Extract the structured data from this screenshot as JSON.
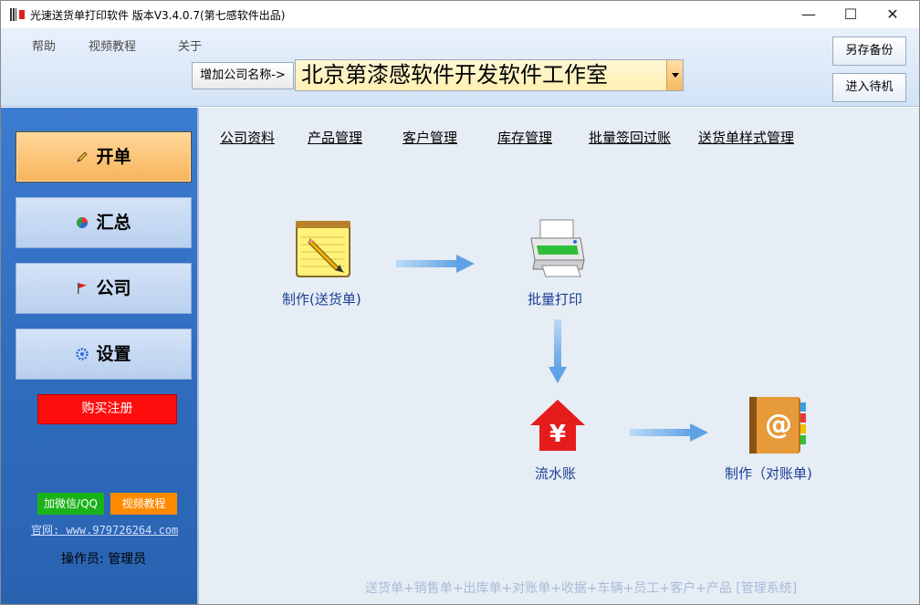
{
  "window": {
    "title": "光速送货单打印软件 版本V3.4.0.7(第七感软件出品)",
    "controls": {
      "minimize": "—",
      "maximize": "☐",
      "close": "✕"
    }
  },
  "menu": {
    "items": [
      "帮助",
      "视频教程",
      "关于"
    ]
  },
  "company": {
    "add_label": "增加公司名称->",
    "selected": "北京第漆感软件开发软件工作室"
  },
  "header_buttons": {
    "backup": "另存备份",
    "standby": "进入待机"
  },
  "sidebar": {
    "nav": [
      {
        "label": "开单",
        "icon": "pencil-icon",
        "active": true
      },
      {
        "label": "汇总",
        "icon": "pie-chart-icon",
        "active": false
      },
      {
        "label": "公司",
        "icon": "flag-icon",
        "active": false
      },
      {
        "label": "设置",
        "icon": "gear-icon",
        "active": false
      }
    ],
    "buy_label": "购买注册",
    "wechat_label": "加微信/QQ",
    "video_label": "视频教程",
    "website": "官网: www.979726264.com",
    "operator": "操作员: 管理员"
  },
  "main": {
    "top_links": [
      "公司资料",
      "产品管理",
      "客户管理",
      "库存管理",
      "批量签回过账",
      "送货单样式管理"
    ],
    "flow": {
      "make_delivery": "制作(送货单)",
      "batch_print": "批量打印",
      "journal": "流水账",
      "make_statement": "制作（对账单)"
    },
    "footer": "送货单+销售单+出库单+对账单+收据+车辆+员工+客户+产品 [管理系统]"
  },
  "colors": {
    "sidebar_bg": "#2f6bbd",
    "active_nav": "#f7b45a",
    "buy_button": "#ff0d0d",
    "wechat_button": "#19b319",
    "video_button": "#ff8a00",
    "flow_label": "#1a3e93"
  }
}
